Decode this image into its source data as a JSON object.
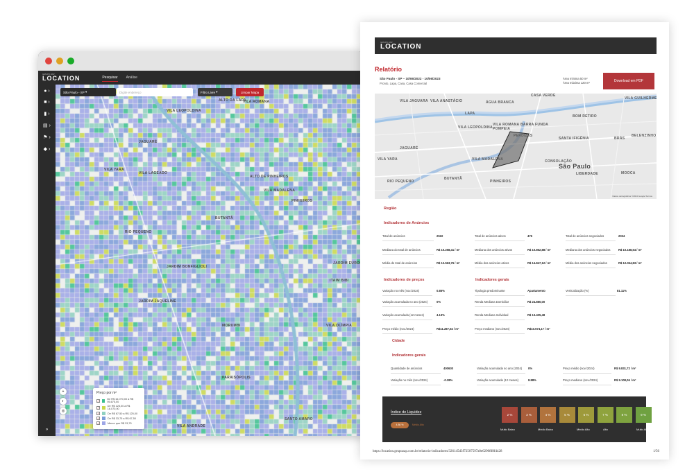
{
  "browser": {
    "logo_small": "GRUPO ZAP",
    "logo": "LOCATION",
    "tabs": [
      "Pesquisar",
      "Análise"
    ],
    "sidebar_icons": [
      "location-pin-icon",
      "layers-icon",
      "bookmark-icon",
      "document-icon",
      "flag-icon",
      "stack-icon"
    ],
    "collapse_glyph": "»",
    "map_controls": {
      "city": "São Paulo - SP",
      "search_placeholder": "Digite endereço",
      "filter": "Filtro Livre",
      "clear": "Limpar Mapa"
    },
    "map_labels": [
      "ALTO DA LAPA",
      "VILA ROMANA",
      "VILA LEOPOLDINA",
      "JAGUARÉ",
      "VILA YARA",
      "VILA LAGEADO",
      "ALTO DE PINHEIROS",
      "VILA MADALENA",
      "PINHEIROS",
      "BUTANTÃ",
      "RIO PEQUENO",
      "JARDIM BONFIGLIOLI",
      "JARDIM JAQUELINE",
      "MORUMBI",
      "VILA OLÍMPIA",
      "PARAISÓPOLIS",
      "VILA ANDRADE",
      "SANTO AMARO",
      "ITAIM BIBI",
      "JARDIM EUROPA"
    ],
    "legend": {
      "title": "Preço por m²",
      "items": [
        {
          "label": "De R$ 16.070,00 a R$ 95.675,00",
          "color": "#3bbf8e"
        },
        {
          "label": "De R$ 125,00 a R$ 16.070,00",
          "color": "#c9d84a"
        },
        {
          "label": "De R$ 67,50 a R$ 125,00",
          "color": "#8fd0c0"
        },
        {
          "label": "De R$ 33,75 a R$ 67,50",
          "color": "#7a9bd8"
        },
        {
          "label": "Menor que R$ 33,75",
          "color": "#9ea6e6"
        }
      ]
    }
  },
  "report": {
    "logo_small": "GRUPO ZAP",
    "logo": "LOCATION",
    "title": "Relatório",
    "place": "São Paulo - SP – 10/06/2022 - 10/06/2023",
    "place_sub": "Pronto, Lapa, Casa, Casa Comercial",
    "area_min": "Área mínima 50 m²",
    "area_max": "Área máxima 120 m²",
    "download": "Download em PDF",
    "map_labels": [
      "VILA JAGUARA",
      "VILA ANASTÁCIO",
      "ÁGUA BRANCA",
      "CASA VERDE",
      "VILA GUILHERME",
      "LAPA",
      "VILA LEOPOLDINA",
      "VILA ROMANA",
      "BARRA FUNDA",
      "BOM RETIRO",
      "POMPEIA",
      "PERDIZES",
      "SANTA IFIGÊNIA",
      "BRÁS",
      "BELENZINHO",
      "JAGUARÉ",
      "VILA MADALENA",
      "CONSOLAÇÃO",
      "São Paulo",
      "VILA YARA",
      "LIBERDADE",
      "MOOCA",
      "RIO PEQUENO",
      "BUTANTÃ",
      "PINHEIROS"
    ],
    "map_credit": "Dados cartográficos ©2024 Google  Termos",
    "region": {
      "title": "Região",
      "ads": {
        "title": "Indicadores de Anúncios",
        "rows": [
          [
            {
              "label": "Total de anúncios",
              "value": "2510"
            },
            {
              "label": "Total de anúncios ativos",
              "value": "476"
            },
            {
              "label": "Total de anúncios negociados",
              "value": "2034"
            }
          ],
          [
            {
              "label": "Mediana do total de anúncios",
              "value": "R$ 10.258,41 / m²"
            },
            {
              "label": "Mediana dos anúncios ativos",
              "value": "R$ 10.862,88 / m²"
            },
            {
              "label": "Mediana dos anúncios negociados",
              "value": "R$ 10.188,54 / m²"
            }
          ],
          [
            {
              "label": "Média do total de anúncios",
              "value": "R$ 12.563,76 / m²"
            },
            {
              "label": "Média dos anúncios ativos",
              "value": "R$ 14.847,12 / m²"
            },
            {
              "label": "Média dos anúncios negociados",
              "value": "R$ 12.064,83 / m²"
            }
          ]
        ]
      },
      "prices": {
        "title": "Indicadores de preços",
        "rows": [
          {
            "label": "Variação no mês (nov./2024)",
            "value": "0.85%"
          },
          {
            "label": "Variação acumulada no ano (2024)",
            "value": "0%"
          },
          {
            "label": "Variação acumulada (12 meses)",
            "value": "4.13%"
          },
          {
            "label": "Preço médio (nov./2024)",
            "value": "R$11.287,54 / m²"
          }
        ]
      },
      "general": {
        "title": "Indicadores gerais",
        "rows": [
          {
            "label": "Tipologia predominante",
            "value": "Apartamento"
          },
          {
            "label": "Renda Mediana Domiciliar",
            "value": "R$ 24.880,00"
          },
          {
            "label": "Renda Mediana Individual",
            "value": "R$ 13.405,48"
          },
          {
            "label": "Preço mediano (nov./2024)",
            "value": "R$10.674,17 / m²"
          }
        ],
        "vertical": {
          "label": "Verticalização (%)",
          "value": "81.11%"
        }
      }
    },
    "city": {
      "title": "Cidade",
      "general_title": "Indicadores gerais",
      "rows": [
        [
          {
            "label": "Quantidade de anúncios",
            "value": "400630"
          },
          {
            "label": "Variação acumulada no ano (2024)",
            "value": "0%"
          },
          {
            "label": "Preço médio (nov./2024)",
            "value": "R$ 9.831,72 / m²"
          }
        ],
        [
          {
            "label": "Variação no mês (nov./2024)",
            "value": "-0.38%"
          },
          {
            "label": "Variação acumulada (12 meses)",
            "value": "8.88%"
          },
          {
            "label": "Preço mediano (nov./2024)",
            "value": "R$ 9.108,06 / m²"
          }
        ]
      ]
    },
    "liquidity": {
      "title": "Índice de Liquidez",
      "pill": "4.86 %",
      "pill_text": "Médio Alto",
      "boxes": [
        {
          "label": "2 %",
          "color": "#a7473a"
        },
        {
          "label": "3 %",
          "color": "#a95e3b"
        },
        {
          "label": "4 %",
          "color": "#b1733d"
        },
        {
          "label": "5 %",
          "color": "#a88a3a"
        },
        {
          "label": "6 %",
          "color": "#9e9a3b"
        },
        {
          "label": "7 %",
          "color": "#8fa33d"
        },
        {
          "label": "8 %",
          "color": "#7ea33f"
        },
        {
          "label": "9 %",
          "color": "#6fa141"
        }
      ],
      "scale_labels": [
        "Muito Baixo",
        "Médio Baixo",
        "Médio Alto",
        "Alto",
        "Muito Alto"
      ]
    },
    "url": "https://location.grupozap.com.br/relatorio-indicadores/326145d3f72507597a0e62908f8f4428",
    "page": "1/56"
  }
}
